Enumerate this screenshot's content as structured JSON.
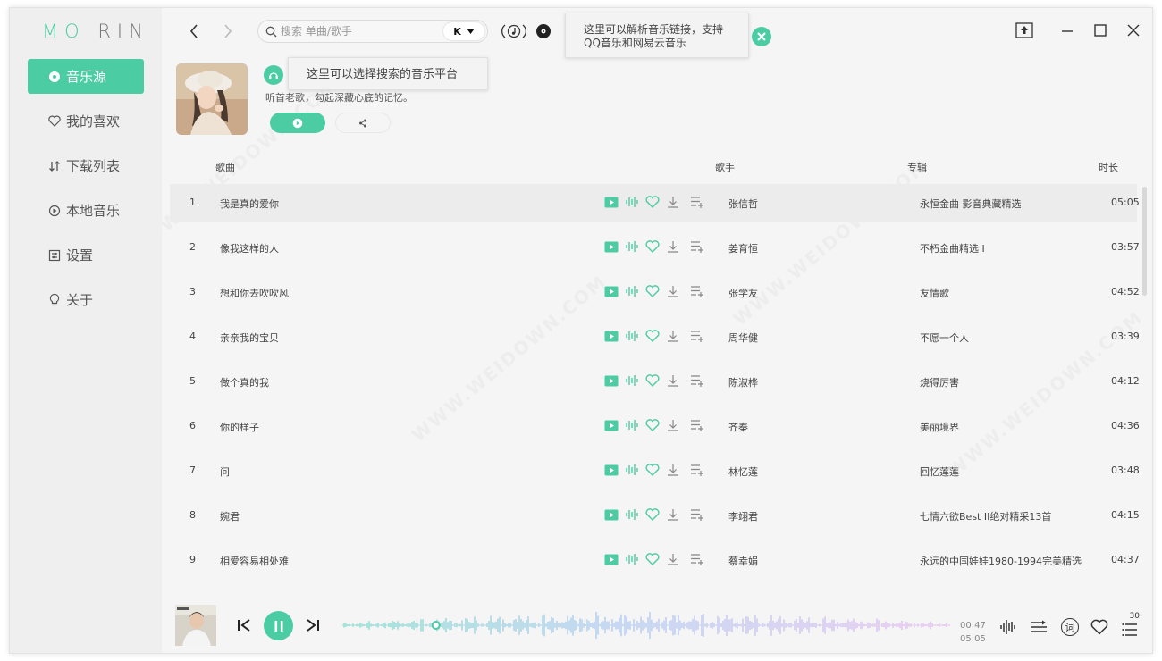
{
  "app": {
    "logo_left": "MO",
    "logo_right": "RIN"
  },
  "sidebar": {
    "items": [
      {
        "label": "音乐源",
        "icon": "music-source-icon",
        "active": true
      },
      {
        "label": "我的喜欢",
        "icon": "heart-icon",
        "active": false
      },
      {
        "label": "下载列表",
        "icon": "download-list-icon",
        "active": false
      },
      {
        "label": "本地音乐",
        "icon": "local-music-icon",
        "active": false
      },
      {
        "label": "设置",
        "icon": "settings-icon",
        "active": false
      },
      {
        "label": "关于",
        "icon": "bulb-icon",
        "active": false
      }
    ]
  },
  "search": {
    "placeholder": "搜索 单曲/歌手",
    "value": "",
    "platform": "K"
  },
  "tooltips": {
    "parse_link": "这里可以解析音乐链接，支持QQ音乐和网易云音乐",
    "platform_select": "这里可以选择搜索的音乐平台"
  },
  "playlist": {
    "description": "听首老歌，勾起深藏心底的记忆。"
  },
  "table": {
    "headers": {
      "song": "歌曲",
      "artist": "歌手",
      "album": "专辑",
      "duration": "时长"
    },
    "rows": [
      {
        "index": "1",
        "title": "我是真的爱你",
        "artist": "张信哲",
        "album": "永恒金曲 影音典藏精选",
        "duration": "05:05",
        "highlighted": true
      },
      {
        "index": "2",
        "title": "像我这样的人",
        "artist": "姜育恒",
        "album": "不朽金曲精选 Ⅰ",
        "duration": "03:57",
        "highlighted": false
      },
      {
        "index": "3",
        "title": "想和你去吹吹风",
        "artist": "张学友",
        "album": "友情歌",
        "duration": "04:52",
        "highlighted": false
      },
      {
        "index": "4",
        "title": "亲亲我的宝贝",
        "artist": "周华健",
        "album": "不愿一个人",
        "duration": "03:39",
        "highlighted": false
      },
      {
        "index": "5",
        "title": "做个真的我",
        "artist": "陈淑桦",
        "album": "烧得厉害",
        "duration": "04:12",
        "highlighted": false
      },
      {
        "index": "6",
        "title": "你的样子",
        "artist": "齐秦",
        "album": "美丽境界",
        "duration": "04:36",
        "highlighted": false
      },
      {
        "index": "7",
        "title": "问",
        "artist": "林忆莲",
        "album": "回忆莲莲",
        "duration": "03:48",
        "highlighted": false
      },
      {
        "index": "8",
        "title": "婉君",
        "artist": "李翊君",
        "album": "七情六欲Best II绝对精采13首",
        "duration": "04:15",
        "highlighted": false
      },
      {
        "index": "9",
        "title": "相爱容易相处难",
        "artist": "蔡幸娟",
        "album": "永远的中国娃娃1980-1994完美精选",
        "duration": "04:37",
        "highlighted": false
      }
    ]
  },
  "player": {
    "current_time": "00:47",
    "total_time": "05:05",
    "progress": 0.154,
    "lyrics_label": "词",
    "playlist_count": "30"
  },
  "watermark": "WWW.WEIDOWN.COM",
  "colors": {
    "accent": "#4ccca3",
    "wave_start": "#6fd8c8",
    "wave_mid": "#a9c6f0",
    "wave_end": "#e3b6f0"
  }
}
